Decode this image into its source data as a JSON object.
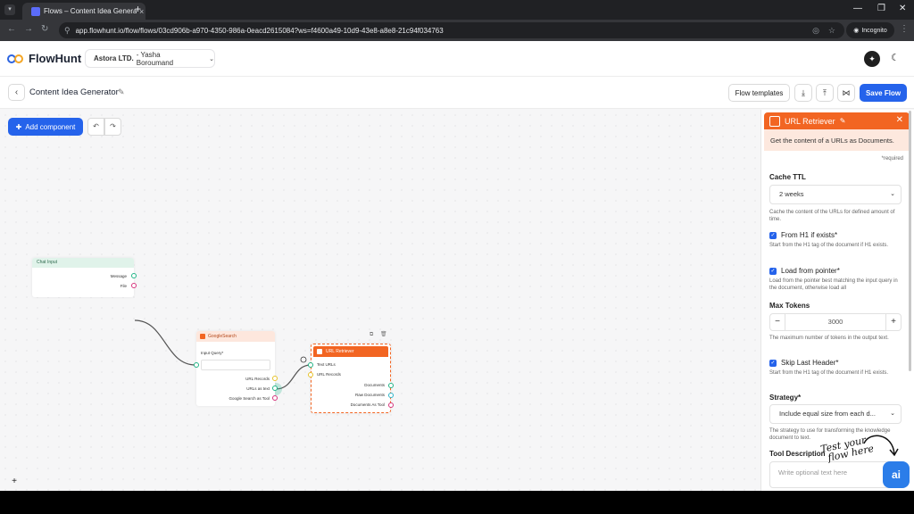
{
  "browser": {
    "tab_title": "Flows – Content Idea Generator",
    "tab_close": "×",
    "new_tab": "+",
    "url": "app.flowhunt.io/flow/flows/03cd906b-a970-4350-986a-0eacd2615084?ws=f4600a49-10d9-43e8-a8e8-21c94f034763",
    "incognito_label": "Incognito"
  },
  "app": {
    "brand": "FlowHunt",
    "workspace_org": "Astora LTD.",
    "workspace_user": "- Yasha Boroumand",
    "flow_title": "Content Idea Generator",
    "buttons": {
      "flow_templates": "Flow templates",
      "save_flow": "Save Flow",
      "add_component": "Add component"
    }
  },
  "canvas": {
    "chat_input": {
      "title": "Chat Input",
      "outputs": [
        "Message",
        "File"
      ]
    },
    "google_search": {
      "title": "GoogleSearch",
      "input_label": "Input Query*",
      "outputs": [
        "URL Records",
        "URLs as text",
        "Google Search as Tool"
      ]
    },
    "url_retriever": {
      "title": "URL Retriever",
      "inputs": [
        "Text URLs",
        "URL Records"
      ],
      "outputs": [
        "Documents",
        "Raw Documents",
        "Documents As Tool"
      ]
    }
  },
  "panel": {
    "title": "URL Retriever",
    "description": "Get the content of a URLs as Documents.",
    "required_note": "*required",
    "cache_ttl": {
      "label": "Cache TTL",
      "value": "2 weeks",
      "help": "Cache the content of the URLs for defined amount of time."
    },
    "from_h1": {
      "label": "From H1 if exists*",
      "checked": true,
      "help": "Start from the H1 tag of the document if H1 exists."
    },
    "load_from_pointer": {
      "label": "Load from pointer*",
      "checked": true,
      "help": "Load from the pointer best matching the input query in the document, otherwise load all"
    },
    "max_tokens": {
      "label": "Max Tokens",
      "value": "3000",
      "help": "The maximum number of tokens in the output text."
    },
    "skip_last_header": {
      "label": "Skip Last Header*",
      "checked": true,
      "help": "Start from the H1 tag of the document if H1 exists."
    },
    "strategy": {
      "label": "Strategy*",
      "value": "Include equal size from each d...",
      "help": "The strategy to use for transforming the knowledge document to text."
    },
    "tool_description": {
      "label": "Tool Description",
      "placeholder": "Write optional text here"
    }
  },
  "overlay": {
    "note_line1": "Test your",
    "note_line2": "flow here",
    "ai_button": "ai"
  },
  "colors": {
    "accent_blue": "#2563eb",
    "node_orange": "#f26522",
    "port_green": "#20b486",
    "port_yellow": "#e6c229",
    "port_pink": "#d6337c"
  }
}
